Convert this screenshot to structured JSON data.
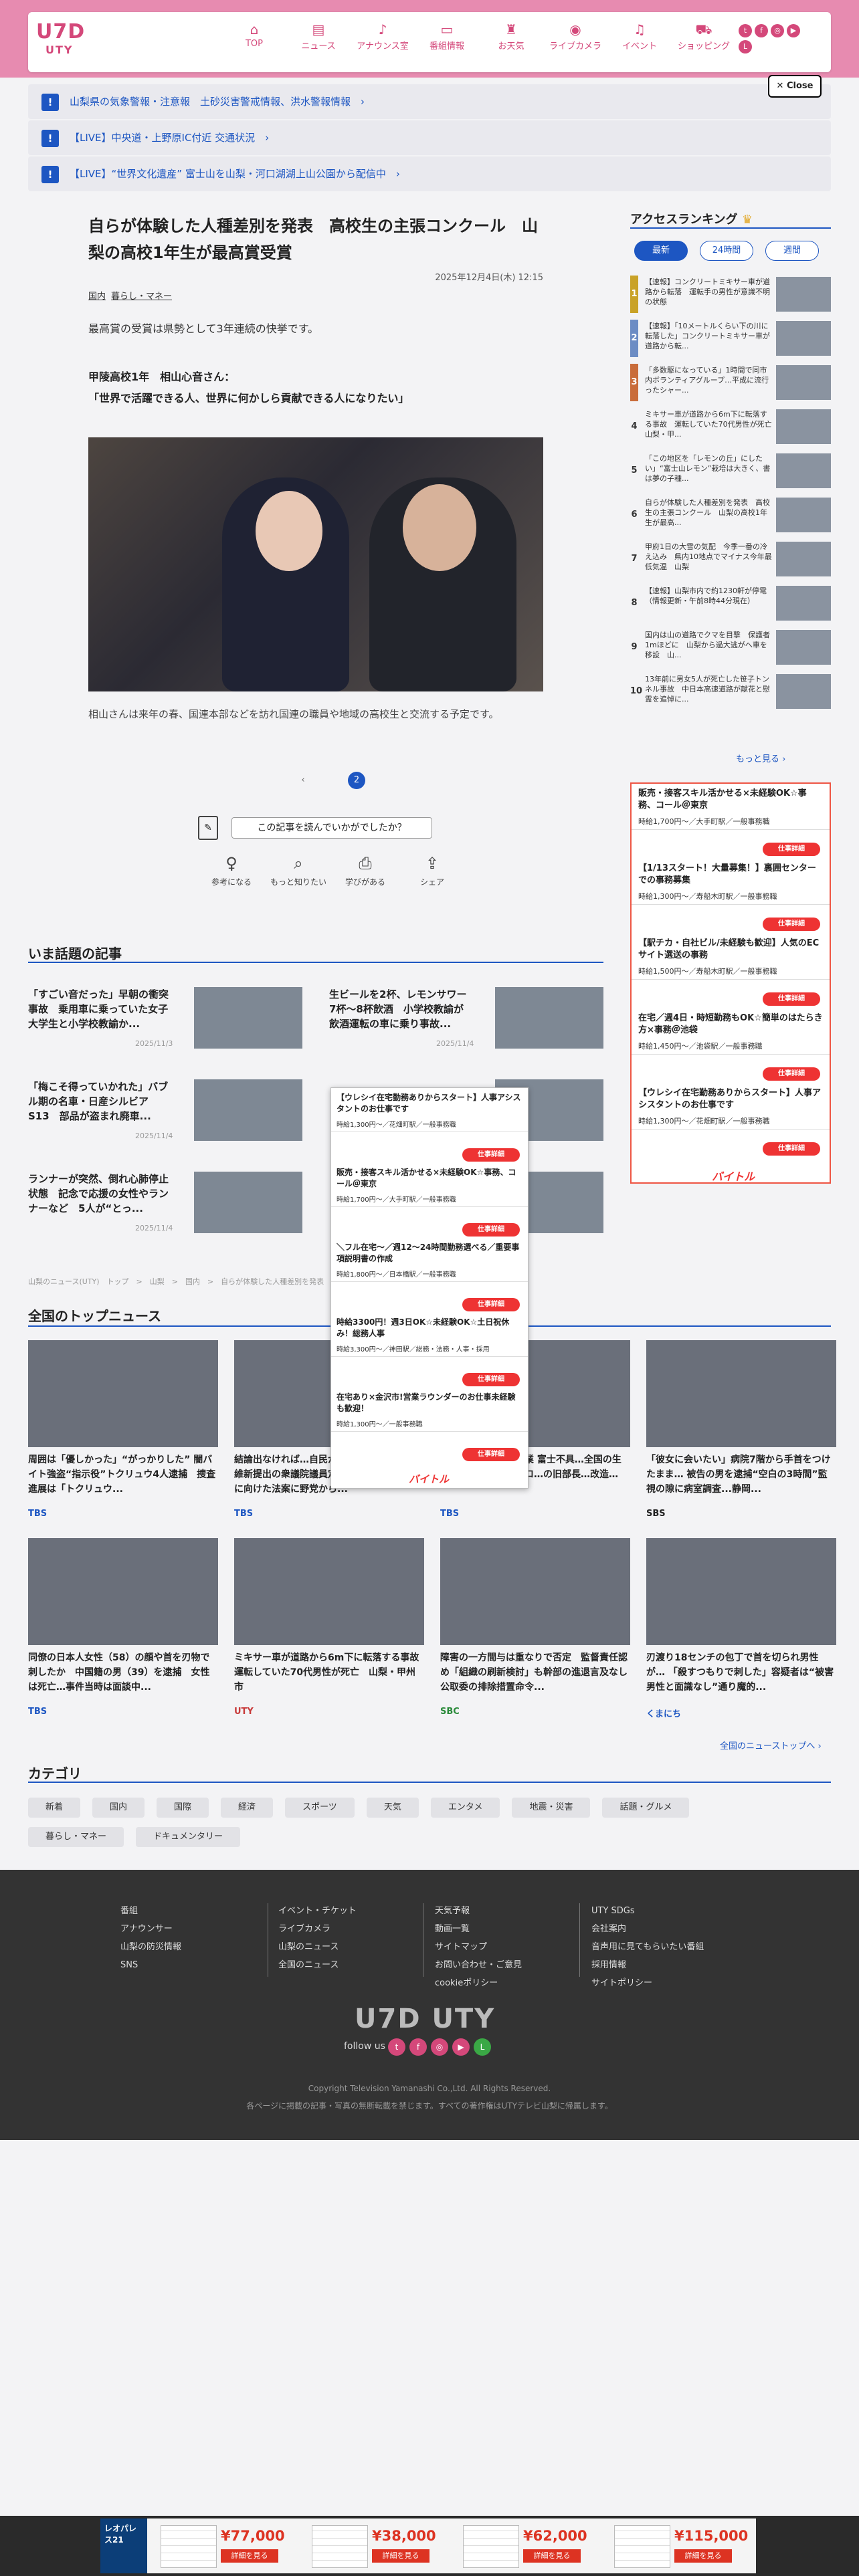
{
  "brand": {
    "logo_main": "U7D",
    "logo_sub": "UTY"
  },
  "nav": [
    {
      "icon": "⌂",
      "label": "TOP"
    },
    {
      "icon": "▤",
      "label": "ニュース"
    },
    {
      "icon": "♪",
      "label": "アナウンス室"
    },
    {
      "icon": "▭",
      "label": "番組情報"
    },
    {
      "icon": "♜",
      "label": "お天気"
    },
    {
      "icon": "◉",
      "label": "ライブカメラ"
    },
    {
      "icon": "♫",
      "label": "イベント"
    },
    {
      "icon": "⛟",
      "label": "ショッピング"
    }
  ],
  "close_label": "Close",
  "alerts": [
    "山梨県の気象警報・注意報　土砂災害警戒情報、洪水警報情報",
    "【LIVE】中央道・上野原IC付近 交通状況",
    "【LIVE】“世界文化遺産” 富士山を山梨・河口湖湖上山公園から配信中"
  ],
  "article": {
    "title": "自らが体験した人種差別を発表　高校生の主張コンクール　山梨の高校1年生が最高賞受賞",
    "date": "2025年12月4日(木) 12:15",
    "tags": [
      "国内",
      "暮らし・マネー"
    ],
    "lead": "最高賞の受賞は県勢として3年連続の快挙です。",
    "quote_head": "甲陵高校1年　相山心音さん：",
    "quote": "「世界で活躍できる人、世界に何かしら貢献できる人になりたい」",
    "caption": "相山さんは来年の春、国連本部などを訪れ国連の職員や地域の高校生と交流する予定です。",
    "pages": [
      "1",
      "2"
    ],
    "feedback_q": "この記事を読んでいかがでしたか？",
    "feedback_btns": [
      {
        "icon": "♀",
        "label": "参考になる"
      },
      {
        "icon": "⌕",
        "label": "もっと知りたい"
      },
      {
        "icon": "⎙",
        "label": "学びがある"
      },
      {
        "icon": "⇪",
        "label": "シェア"
      }
    ]
  },
  "ranking": {
    "title": "アクセスランキング",
    "tabs": [
      "最新",
      "24時間",
      "週間"
    ],
    "items": [
      "【速報】コンクリートミキサー車が道路から転落　運転手の男性が意識不明の状態",
      "【速報】「10メートルくらい下の川に転落した」コンクリートミキサー車が道路から転...",
      "「多数駆になっている」1時間で同市内ボランティアグループ…平成に流行ったシャー...",
      "ミキサー車が道路から6m下に転落する事故　運転していた70代男性が死亡　山梨・甲...",
      "「この地区を「レモンの丘」にしたい」“富士山レモン”栽培は大きく、書は夢の子種...",
      "自らが体験した人種差別を発表　高校生の主張コンクール　山梨の高校1年生が最高...",
      "甲府1日の大雪の気配　今季一番の冷え込み　県内10地点でマイナス今年最低気温　山梨",
      "【速報】山梨市内で約1230軒が停電（情報更新・午前8時44分現在）",
      "国内は山の道路でクマを目撃　保護者1mほどに　山梨から過大逃がへ車を移設　山...",
      "13年前に男女5人が死亡した笹子トンネル事故　中日本高速道路が献花と慰霊を追悼に..."
    ],
    "bar_colors": [
      "#c9a227",
      "#6c8cc4",
      "#c96c3a",
      "#333333",
      "#333333",
      "#333333",
      "#333333",
      "#333333",
      "#333333",
      "#333333"
    ],
    "more": "もっと見る"
  },
  "jobad": {
    "items": [
      {
        "t": "販売・接客スキル活かせる×未経験OK☆事務、コール＠東京",
        "s": "時給1,700円～／大手町駅／一般事務職"
      },
      {
        "t": "【1/13スタート！大量募集！】裏囲センターでの事務募集",
        "s": "時給1,300円～／寿船木町駅／一般事務職"
      },
      {
        "t": "【駅チカ・自社ビル/未経験も歓迎】人気のECサイト選送の事務",
        "s": "時給1,500円～／寿船木町駅／一般事務職"
      },
      {
        "t": "在宅／週4日・時短勤務もOK☆簡単のはたらき方×事務＠池袋",
        "s": "時給1,450円～／池袋駅／一般事務職"
      },
      {
        "t": "【ウレシイ在宅勤務ありからスタート】人事アシスタントのお仕事です",
        "s": "時給1,300円～／花畑町駅／一般事務職"
      }
    ],
    "btn": "仕事詳細",
    "logo": "バイトル"
  },
  "trend": {
    "title": "いま話題の記事",
    "items": [
      {
        "t": "「すごい音だった」早朝の衝突事故　乗用車に乗っていた女子大学生と小学校教諭か...",
        "d": "2025/11/3"
      },
      {
        "t": "生ビールを2杯、レモンサワー7杯〜8杯飲酒　小学校教諭が飲酒運転の車に乗り事故...",
        "d": "2025/11/4"
      },
      {
        "t": "「梅こそ得っていかれた」バブル期の名車・日産シルビアS13　部品が盗まれ廃車...",
        "d": "2025/11/4"
      },
      {
        "t": "",
        "d": ""
      },
      {
        "t": "ランナーが突然、倒れ心肺停止状態　記念で応援の女性やランナーなど　5人が“とっ...",
        "d": "2025/11/4"
      },
      {
        "t": "",
        "d": ""
      }
    ]
  },
  "breadcrumb": "山梨のニュース(UTY)　トップ　>　山梨　>　国内　>　自らが体験した人種差別を発表　高校生の主張コンクール　山梨の高校1年生が最高賞受賞",
  "popup": {
    "items": [
      {
        "t": "【ウレシイ在宅勤務ありからスタート】人事アシスタントのお仕事です",
        "s": "時給1,300円～／花畑町駅／一般事務職"
      },
      {
        "t": "販売・接客スキル活かせる×未経験OK☆事務、コール＠東京",
        "s": "時給1,700円～／大手町駅／一般事務職"
      },
      {
        "t": "＼フル在宅～／週12～24時間勤務選べる／重要事項説明書の作成",
        "s": "時給1,800円～／日本橋駅／一般事務職"
      },
      {
        "t": "時給3300円！週3日OK☆未経験OK☆土日祝休み！総務人事",
        "s": "時給3,300円～／神田駅／総務・法務・人事・採用"
      },
      {
        "t": "在宅あり×金沢市!営業ラウンダーのお仕事未経験も歓迎！",
        "s": "時給1,300円～／一般事務職"
      }
    ],
    "btn": "仕事詳細",
    "logo": "バイトル"
  },
  "topnews": {
    "title": "全国のトップニュース",
    "items": [
      {
        "t": "周囲は「優しかった」“がっかりした” 闇バイト強盗“指示役”トクリュウ4人逮捕　捜査進展は「トクリュウ...",
        "src": "TBS"
      },
      {
        "t": "結論出なければ…自民が条件提案 実る民・維新提出の衆議院議員定数削減法案 会期末に向けた法案に野党から...",
        "src": "TBS"
      },
      {
        "t": "…旧の総合が米の農業 富士不具…全国の生産者が悩む…ミサイロ…の旧部長…改造…",
        "src": "TBS"
      },
      {
        "t": "「彼女に会いたい」病院7階から手首をつけたまま… 被告の男を逮捕“空白の3時間”監視の隙に病室調査...静岡...",
        "src": "SBS"
      },
      {
        "t": "同僚の日本人女性（58）の顔や首を刃物で刺したか　中国籍の男（39）を逮捕　女性は死亡…事件当時は面談中...",
        "src": "TBS"
      },
      {
        "t": "ミキサー車が道路から6m下に転落する事故　運転していた70代男性が死亡　山梨・甲州市",
        "src": "UTY"
      },
      {
        "t": "障害の一方間与は重なりで否定　監督責任認め「組織の刷新検討」も幹部の進退言及なし　公取委の排除措置命令...",
        "src": "SBC"
      },
      {
        "t": "刃渡り18センチの包丁で首を切られ男性が… 「殺すつもりで刺した」容疑者は“被害男性と面識なし”通り魔的...",
        "src": "くまにち"
      }
    ],
    "src_colors": [
      "#1d56c2",
      "#1d56c2",
      "#1d56c2",
      "#222222",
      "#1d56c2",
      "#c83a3a",
      "#2a8a3a",
      "#1d56c2"
    ],
    "more": "全国のニューストップへ"
  },
  "categories": {
    "title": "カテゴリ",
    "row1": [
      "新着",
      "国内",
      "国際",
      "経済",
      "スポーツ",
      "天気",
      "エンタメ",
      "地震・災害",
      "話題・グルメ"
    ],
    "row2": [
      "暮らし・マネー",
      "ドキュメンタリー"
    ]
  },
  "footer": {
    "col1": [
      "番組",
      "アナウンサー",
      "山梨の防災情報",
      "SNS"
    ],
    "col2": [
      "イベント・チケット",
      "ライブカメラ",
      "山梨のニュース",
      "全国のニュース"
    ],
    "col3": [
      "天気予報",
      "動画一覧",
      "サイトマップ",
      "お問い合わせ・ご意見",
      "cookieポリシー"
    ],
    "col4": [
      "UTY SDGs",
      "会社案内",
      "音声用に見てもらいたい番組",
      "採用情報",
      "サイトポリシー"
    ],
    "logo": "U7D UTY",
    "follow": "follow us",
    "copyright": "Copyright Television Yamanashi Co.,Ltd. All Rights Reserved.",
    "notice": "各ページに掲載の記事・写真の無断転載を禁じます。すべての著作権はUTYテレビ山梨に帰属します。"
  },
  "bottom_ad": {
    "logo": "レオパレス21",
    "prices": [
      "¥77,000",
      "¥38,000",
      "¥62,000",
      "¥115,000"
    ],
    "btn": "詳細を見る"
  }
}
